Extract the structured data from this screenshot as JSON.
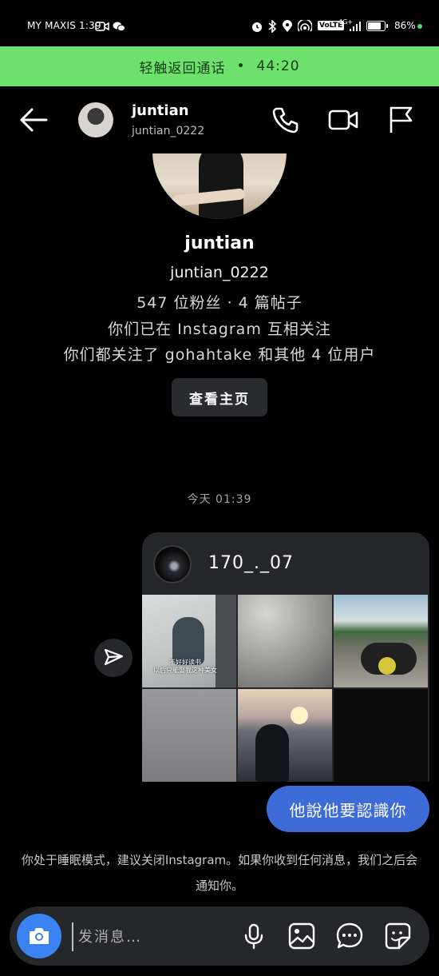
{
  "status_bar": {
    "carrier_time": "MY MAXIS 1:39",
    "volte": "VoLTE",
    "network": "4G+",
    "battery_text": "86%",
    "battery_level": 0.86,
    "icons": [
      "video-call-icon",
      "wechat-icon",
      "alarm-icon",
      "bluetooth-icon",
      "location-icon",
      "hotspot-icon",
      "signal-icon",
      "battery-icon"
    ]
  },
  "call_banner": {
    "label": "轻触返回通话",
    "separator": "•",
    "duration": "44:20",
    "color": "#6ee06c"
  },
  "header": {
    "name": "juntian",
    "username": "juntian_0222",
    "icons": [
      "back-arrow-icon",
      "phone-icon",
      "video-icon",
      "flag-icon"
    ]
  },
  "profile": {
    "name": "juntian",
    "username": "juntian_0222",
    "stats": "547 位粉丝 · 4 篇帖子",
    "mutual_follow": "你们已在 Instagram 互相关注",
    "mutual_friends": "你们都关注了 gohahtake 和其他 4 位用户",
    "view_profile_label": "查看主页"
  },
  "timestamp": "今天 01:39",
  "shared_card": {
    "username": "170_._07",
    "tile_caption": "不好好读书\n以后只能娶我这种美女",
    "share_icon": "send-icon"
  },
  "my_message": {
    "text": "他說他要認識你",
    "bubble_color": "#3d6bd8"
  },
  "sleep_notice": "你处于睡眠模式，建议关闭Instagram。如果你收到任何消息，我们之后会通知你。",
  "composer": {
    "placeholder": "发消息…",
    "camera_color": "#3b83f2",
    "icons": [
      "camera-icon",
      "microphone-icon",
      "image-icon",
      "chat-bubble-icon",
      "sticker-icon"
    ]
  }
}
